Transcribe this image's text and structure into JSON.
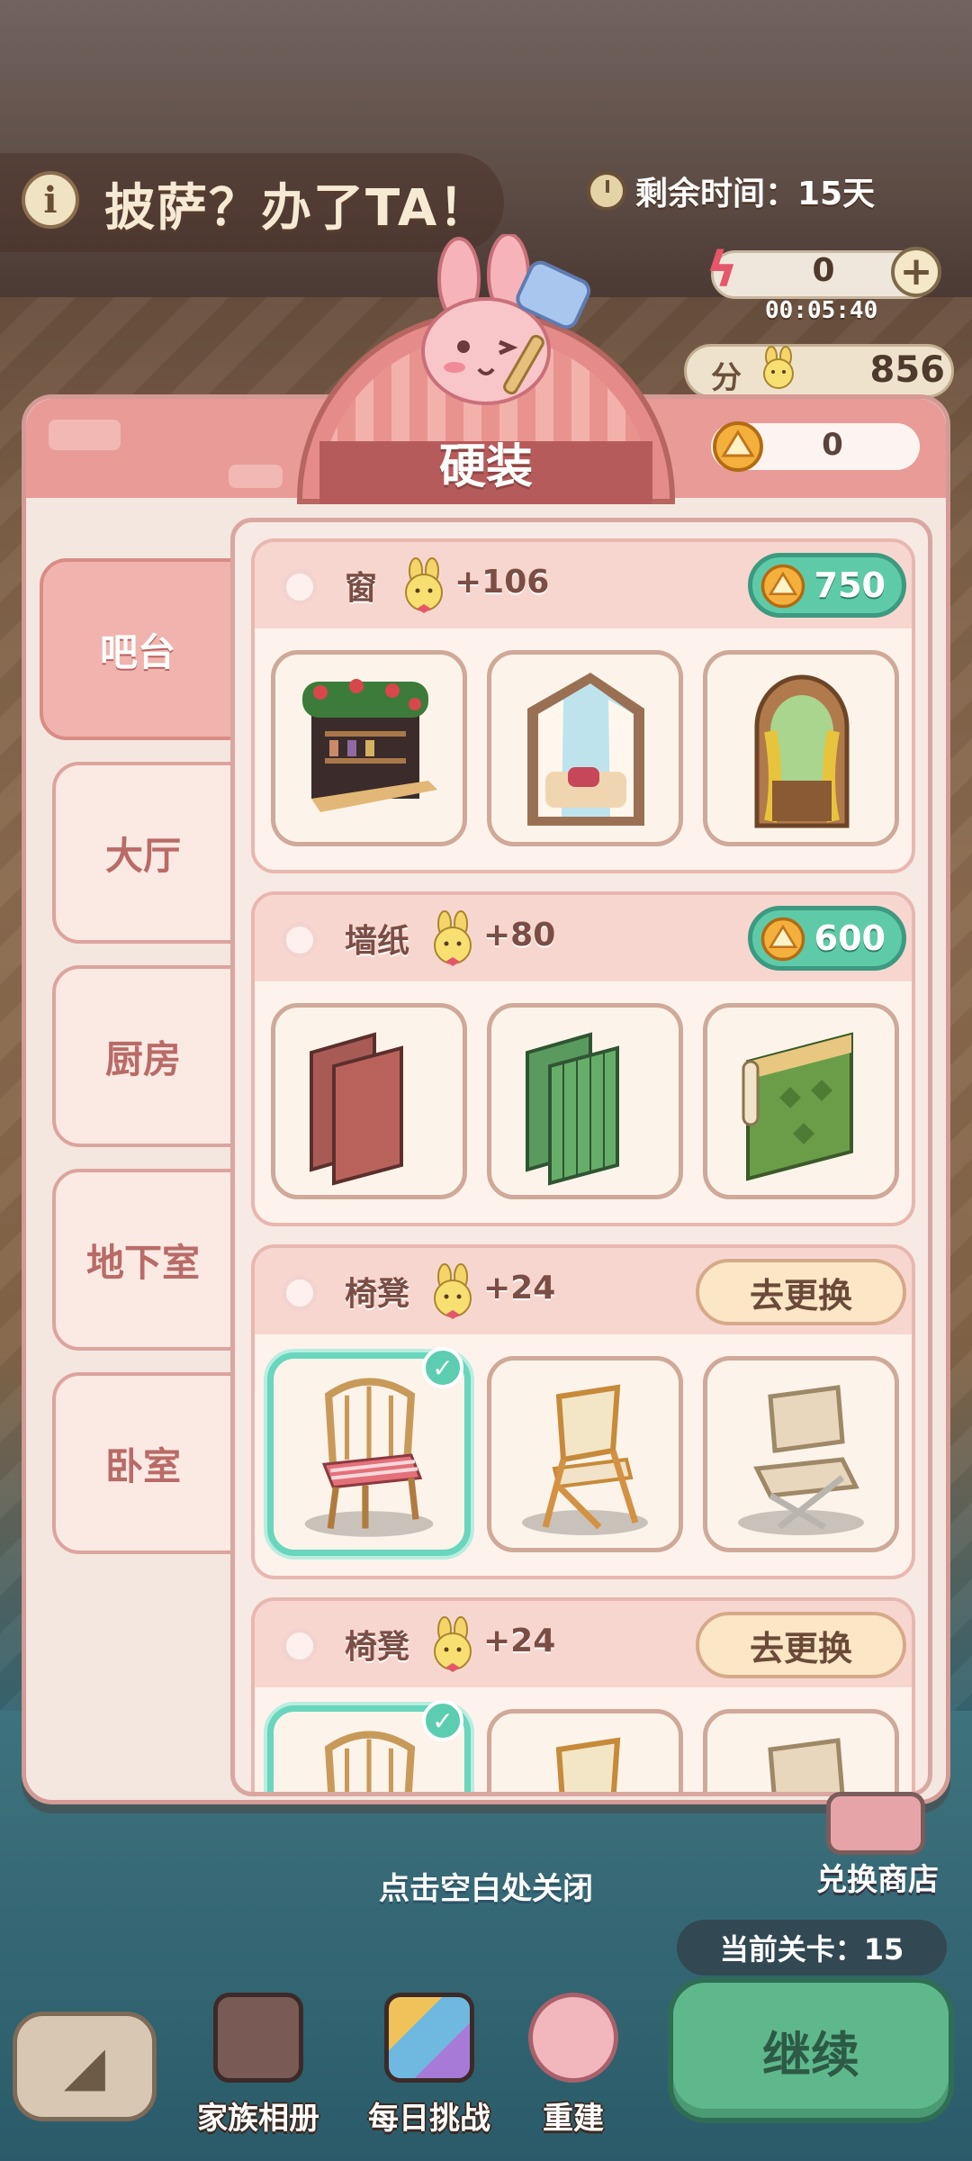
{
  "hud": {
    "title": "披萨？办了TA！",
    "timer": "剩余时间：15天",
    "energy_value": "0",
    "energy_timer": "00:05:40",
    "score_label": "分",
    "score_value": "856",
    "plus_symbol": "+"
  },
  "modal": {
    "title": "硬装",
    "coin_balance": "0",
    "tabs": [
      "吧台",
      "大厅",
      "厨房",
      "地下室",
      "卧室"
    ],
    "active_tab": 0,
    "sections": [
      {
        "name": "窗",
        "score": "+106",
        "action": "750",
        "action_type": "price",
        "selected_index": -1
      },
      {
        "name": "墙纸",
        "score": "+80",
        "action": "600",
        "action_type": "price",
        "selected_index": -1
      },
      {
        "name": "椅凳",
        "score": "+24",
        "action": "去更换",
        "action_type": "swap",
        "selected_index": 0
      },
      {
        "name": "椅凳",
        "score": "+24",
        "action": "去更换",
        "action_type": "swap",
        "selected_index": 0
      }
    ]
  },
  "footer": {
    "close_hint": "点击空白处关闭",
    "shop_label": "兑换商店",
    "level_text": "当前关卡：15",
    "nav": [
      "家族相册",
      "每日挑战",
      "重建"
    ],
    "continue_label": "继续"
  },
  "colors": {
    "accent_pink": "#e99b98",
    "price_green": "#5fcaa8",
    "selected_outline": "#69d6bd",
    "continue_green": "#5fb88c"
  },
  "icons": [
    "info-icon",
    "clock-icon",
    "bolt-icon",
    "plus-icon",
    "coin-icon",
    "bunny-score-icon",
    "check-icon",
    "back-arrow-icon"
  ]
}
